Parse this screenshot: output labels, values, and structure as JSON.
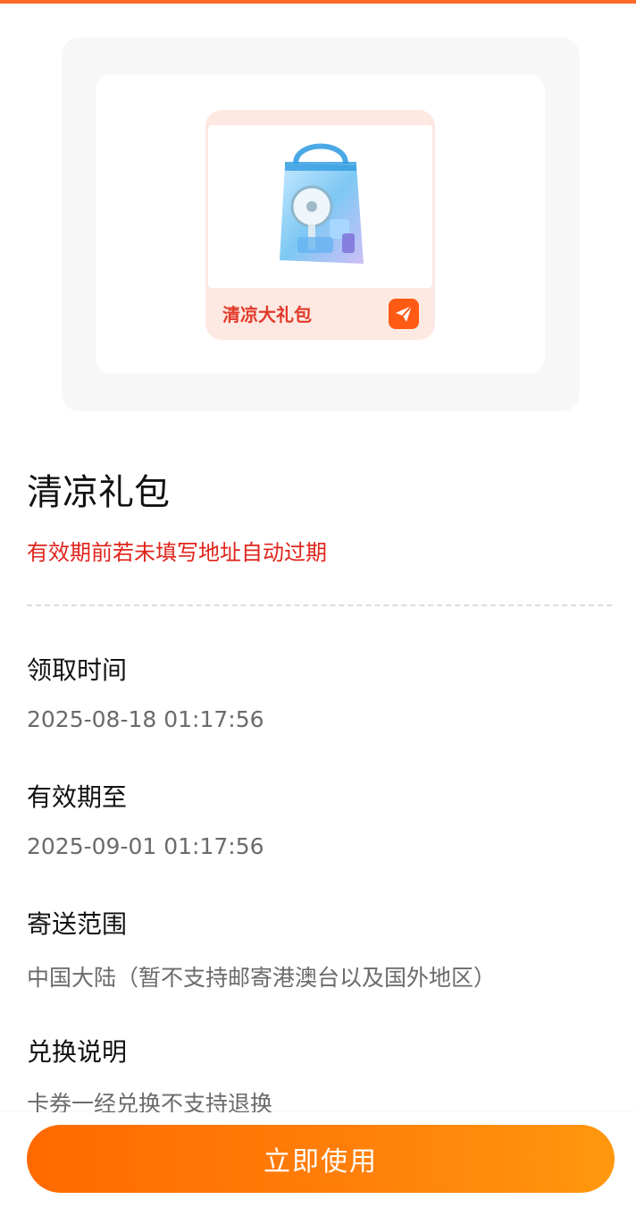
{
  "colors": {
    "accent": "#ff6a2a",
    "warning_text": "#e0241b",
    "button_gradient_start": "#ff6a00",
    "button_gradient_end": "#ff980c"
  },
  "product_card": {
    "label": "清凉大礼包",
    "image_icon": "cooling-gift-bag-icon",
    "badge_icon": "brand-logo-icon"
  },
  "gift": {
    "title": "清凉礼包",
    "expiry_note": "有效期前若未填写地址自动过期"
  },
  "details": [
    {
      "label": "领取时间",
      "value": "2025-08-18 01:17:56"
    },
    {
      "label": "有效期至",
      "value": "2025-09-01 01:17:56"
    },
    {
      "label": "寄送范围",
      "value": "中国大陆（暂不支持邮寄港澳台以及国外地区）"
    },
    {
      "label": "兑换说明",
      "value": "卡券一经兑换不支持退换"
    }
  ],
  "action": {
    "use_button_label": "立即使用"
  }
}
